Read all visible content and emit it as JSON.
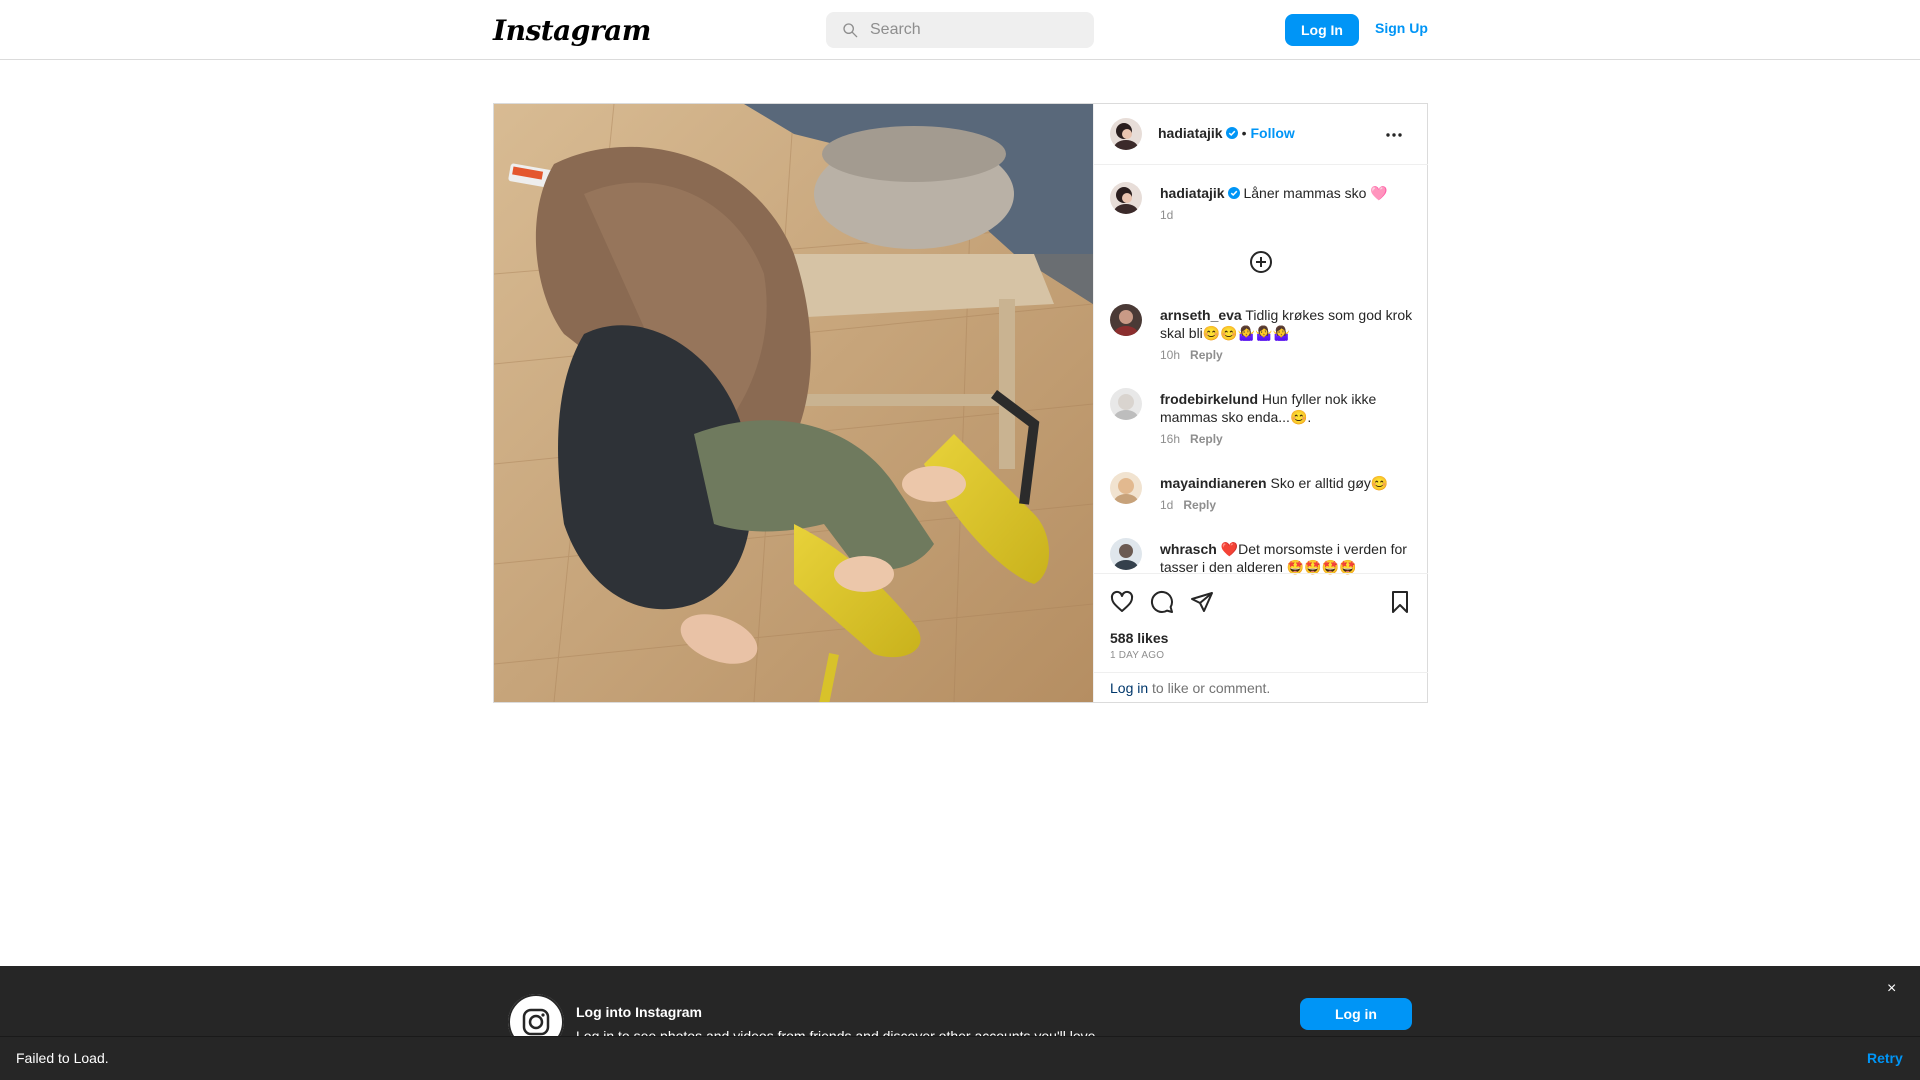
{
  "nav": {
    "logo": "Instagram",
    "search_placeholder": "Search",
    "login_label": "Log In",
    "signup_label": "Sign Up"
  },
  "post": {
    "author": "hadiatajik",
    "follow_label": "Follow",
    "caption": {
      "user": "hadiatajik",
      "text": "Låner mammas sko 🩷",
      "time": "1d"
    },
    "comments": [
      {
        "user": "arnseth_eva",
        "text": "Tidlig krøkes som god krok skal bli😊😊🤷‍♀️🤷‍♀️🤷‍♀️",
        "time": "10h",
        "reply": "Reply"
      },
      {
        "user": "frodebirkelund",
        "text": "Hun fyller nok ikke mammas sko enda...😊.",
        "time": "16h",
        "reply": "Reply"
      },
      {
        "user": "mayaindianeren",
        "text": "Sko er alltid gøy😊",
        "time": "1d",
        "reply": "Reply"
      },
      {
        "user": "whrasch",
        "text": "❤️Det morsomste i verden for tasser i den alderen 🤩🤩🤩🤩",
        "time": "",
        "reply": ""
      }
    ],
    "likes": "588 likes",
    "time_ago": "1 DAY AGO",
    "login_link": "Log in",
    "login_suffix": " to like or comment."
  },
  "banner": {
    "title": "Log into Instagram",
    "subtitle": "Log in to see photos and videos from friends and discover other accounts you'll love.",
    "button": "Log in",
    "close": "×"
  },
  "toast": {
    "message": "Failed to Load.",
    "action": "Retry"
  },
  "colors": {
    "accent": "#0095f6",
    "dark_bar": "#262626",
    "verified": "#0095f6"
  }
}
